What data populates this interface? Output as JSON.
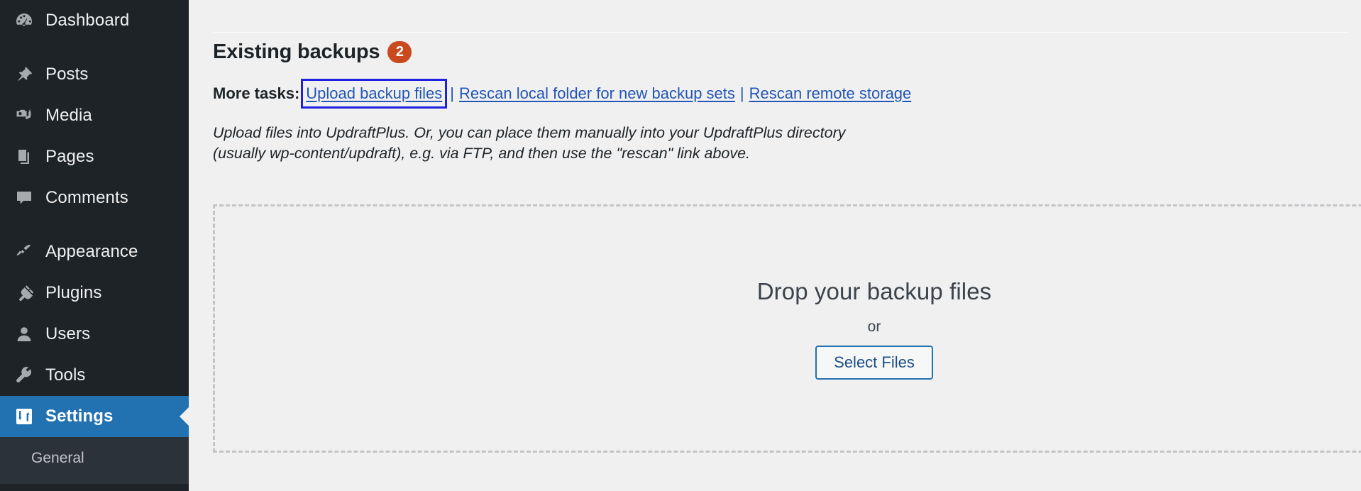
{
  "sidebar": {
    "items": [
      {
        "label": "Dashboard",
        "icon": "dashboard-gauge-icon",
        "name": "dashboard",
        "current": false,
        "gap_after": true
      },
      {
        "label": "Posts",
        "icon": "pin-icon",
        "name": "posts",
        "current": false,
        "gap_after": false
      },
      {
        "label": "Media",
        "icon": "camera-music-icon",
        "name": "media",
        "current": false,
        "gap_after": false
      },
      {
        "label": "Pages",
        "icon": "pages-icon",
        "name": "pages",
        "current": false,
        "gap_after": false
      },
      {
        "label": "Comments",
        "icon": "comment-bubble-icon",
        "name": "comments",
        "current": false,
        "gap_after": true
      },
      {
        "label": "Appearance",
        "icon": "paintbrush-icon",
        "name": "appearance",
        "current": false,
        "gap_after": false
      },
      {
        "label": "Plugins",
        "icon": "plug-icon",
        "name": "plugins",
        "current": false,
        "gap_after": false
      },
      {
        "label": "Users",
        "icon": "user-icon",
        "name": "users",
        "current": false,
        "gap_after": false
      },
      {
        "label": "Tools",
        "icon": "wrench-icon",
        "name": "tools",
        "current": false,
        "gap_after": false
      },
      {
        "label": "Settings",
        "icon": "settings-sliders-icon",
        "name": "settings",
        "current": true,
        "gap_after": false
      }
    ],
    "submenu": [
      {
        "label": "General",
        "name": "general"
      }
    ],
    "colors": {
      "background": "#1d2327",
      "submenu_background": "#2c3338",
      "current_background": "#2271b1",
      "text": "#f0f0f1",
      "submenu_text": "#c3c4c7"
    }
  },
  "main": {
    "heading": "Existing backups",
    "badge_count": "2",
    "badge_color": "#ca4a1f",
    "more_tasks": {
      "label": "More tasks:",
      "links": [
        {
          "text": "Upload backup files",
          "name": "upload-backup-files",
          "focused": true
        },
        {
          "text": "Rescan local folder for new backup sets",
          "name": "rescan-local-folder",
          "focused": false
        },
        {
          "text": "Rescan remote storage",
          "name": "rescan-remote-storage",
          "focused": false
        }
      ],
      "separator": "|",
      "link_color": "#2256b5",
      "focus_outline_color": "#2020e0"
    },
    "upload_description_line1": "Upload files into UpdraftPlus. Or, you can place them manually into your UpdraftPlus directory",
    "upload_description_line2": "(usually wp-content/updraft), e.g. via FTP, and then use the \"rescan\" link above.",
    "dropzone": {
      "title": "Drop your backup files",
      "or_text": "or",
      "button_label": "Select Files",
      "border_color": "#c3c4c7",
      "button_border_color": "#2271b1",
      "button_text_color": "#1d4d85"
    }
  }
}
